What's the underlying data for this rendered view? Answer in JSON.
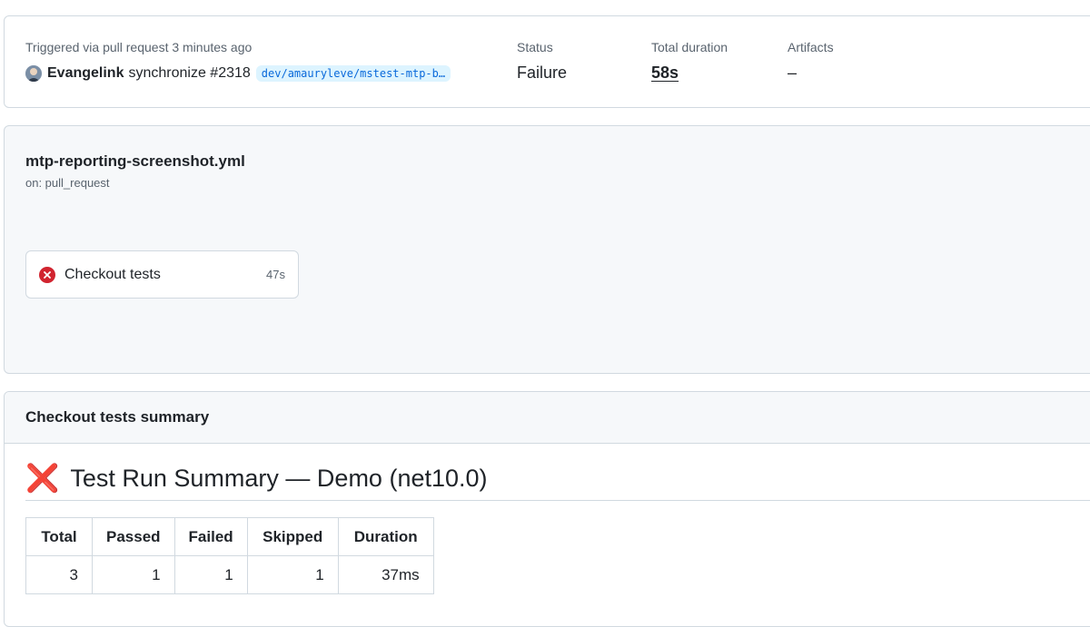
{
  "run": {
    "trigger_text": "Triggered via pull request 3 minutes ago",
    "actor": "Evangelink",
    "event": "synchronize #2318",
    "branch": "dev/amauryleve/mstest-mtp-b…",
    "status_label": "Status",
    "status_value": "Failure",
    "duration_label": "Total duration",
    "duration_value": "58s",
    "artifacts_label": "Artifacts",
    "artifacts_value": "–"
  },
  "workflow": {
    "file_name": "mtp-reporting-screenshot.yml",
    "trigger": "on: pull_request",
    "job": {
      "name": "Checkout tests",
      "duration": "47s",
      "status_icon": "x-circle-icon",
      "status_color": "#d1242f"
    }
  },
  "summary": {
    "header": "Checkout tests summary",
    "title_icon": "❌",
    "title": "Test Run Summary — Demo (net10.0)",
    "table": {
      "headers": [
        "Total",
        "Passed",
        "Failed",
        "Skipped",
        "Duration"
      ],
      "rows": [
        [
          "3",
          "1",
          "1",
          "1",
          "37ms"
        ]
      ]
    }
  },
  "colors": {
    "accent_link": "#0969da",
    "branch_bg": "#ddf4ff",
    "failure": "#d1242f",
    "border": "#d1d9e0",
    "muted_text": "#59636e"
  }
}
